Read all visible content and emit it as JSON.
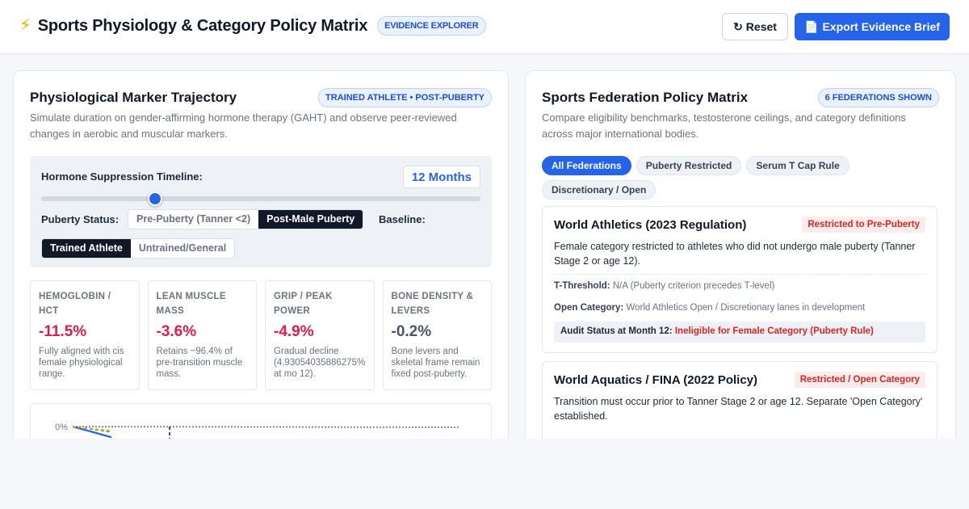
{
  "header": {
    "icon": "lightning-bolt-icon",
    "title": "Sports Physiology & Category Policy Matrix",
    "badge": "EVIDENCE EXPLORER",
    "reset_label": "Reset",
    "export_label": "Export Evidence Brief"
  },
  "left_panel": {
    "title": "Physiological Marker Trajectory",
    "badge": "TRAINED ATHLETE • POST-PUBERTY",
    "subtitle": "Simulate duration on gender-affirming hormone therapy (GAHT) and observe peer-reviewed changes in aerobic and muscular markers.",
    "timeline": {
      "label": "Hormone Suppression Timeline:",
      "value_text": "12 Months",
      "fraction": 0.26
    },
    "puberty": {
      "label": "Puberty Status:",
      "options": [
        "Pre-Puberty (Tanner <2)",
        "Post-Male Puberty"
      ],
      "selected_index": 1
    },
    "baseline": {
      "label": "Baseline:",
      "options": [
        "Trained Athlete",
        "Untrained/General"
      ],
      "selected_index": 0
    },
    "markers": [
      {
        "name": "Hemoglobin / HCT",
        "value": "-11.5%",
        "color": "#e11d48",
        "note": "Fully aligned with cis female physiological range."
      },
      {
        "name": "Lean Muscle Mass",
        "value": "-3.6%",
        "color": "#e11d48",
        "note": "Retains ~96.4% of pre-transition muscle mass."
      },
      {
        "name": "Grip / Peak Power",
        "value": "-4.9%",
        "color": "#e11d48",
        "note": "Gradual decline (4.93054035886275% at mo 12)."
      },
      {
        "name": "Bone Density & Levers",
        "value": "-0.2%",
        "color": "#4b5563",
        "note": "Bone levers and skeletal frame remain fixed post-puberty."
      }
    ],
    "chart_data": {
      "type": "line",
      "y_tick_labels": [
        "0%"
      ],
      "series": [
        {
          "color": "#6b7280",
          "style": "dotted",
          "values": [
            0,
            -0.05,
            -0.1,
            -0.15,
            -0.2,
            -0.25,
            -0.3,
            -0.35,
            -0.4
          ]
        },
        {
          "color": "#2563eb",
          "style": "solid",
          "values": [
            0,
            -3,
            -6
          ]
        },
        {
          "color": "#16a34a",
          "style": "dashed",
          "values": [
            0,
            -1.5,
            -3
          ]
        },
        {
          "color": "#f59e0b",
          "style": "dashed",
          "values": [
            0,
            -1.2,
            -2.4
          ]
        }
      ],
      "marker_month": 12
    }
  },
  "right_panel": {
    "title": "Sports Federation Policy Matrix",
    "badge": "6 FEDERATIONS SHOWN",
    "subtitle": "Compare eligibility benchmarks, testosterone ceilings, and category definitions across major international bodies.",
    "filters": [
      {
        "label": "All Federations",
        "active": true
      },
      {
        "label": "Puberty Restricted",
        "active": false
      },
      {
        "label": "Serum T Cap Rule",
        "active": false
      },
      {
        "label": "Discretionary / Open",
        "active": false
      }
    ],
    "federations": [
      {
        "name": "World Athletics (2023 Regulation)",
        "tag": "Restricted to Pre-Puberty",
        "description": "Female category restricted to athletes who did not undergo male puberty (Tanner Stage 2 or age 12).",
        "t_threshold_label": "T-Threshold:",
        "t_threshold": "N/A (Puberty criterion precedes T-level)",
        "open_label": "Open Category:",
        "open": "World Athletics Open / Discretionary lanes in development",
        "audit_label": "Audit Status at Month 12:",
        "audit_value": "Ineligible for Female Category (Puberty Rule)"
      },
      {
        "name": "World Aquatics / FINA (2022 Policy)",
        "tag": "Restricted / Open Category",
        "description": "Transition must occur prior to Tanner Stage 2 or age 12. Separate 'Open Category' established."
      }
    ]
  }
}
